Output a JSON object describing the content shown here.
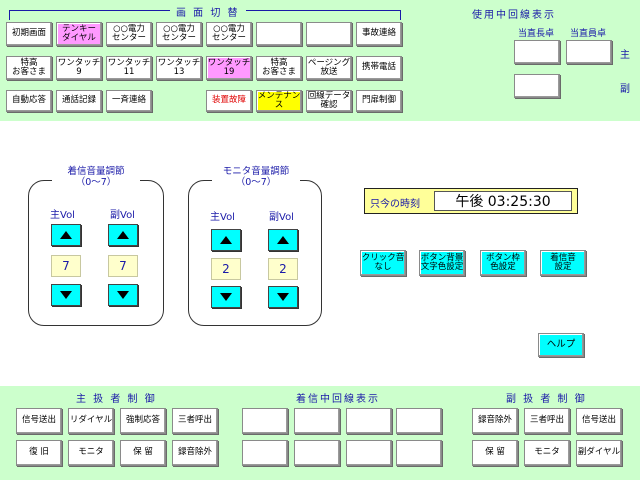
{
  "top_panel": {
    "screen_switch_title": "画 面 切 替",
    "line_in_use_title": "使用中回線表示",
    "duty_chief_label": "当直長卓",
    "duty_member_label": "当直員卓",
    "main_label": "主",
    "sub_label": "副",
    "row1": [
      "初期画面",
      "テンキー\nダイヤル",
      "○○電力\nセンター",
      "○○電力\nセンター",
      "○○電力\nセンター",
      "",
      "",
      "事故連絡"
    ],
    "row2": [
      "特高\nお客さま",
      "ワンタッチ\n9",
      "ワンタッチ\n11",
      "ワンタッチ\n13",
      "ワンタッチ\n19",
      "特高\nお客さま",
      "ページング\n放送",
      "携帯電話"
    ],
    "row3": [
      "自動応答",
      "通話記録",
      "一斉連絡",
      "装置故障",
      "メンテナン\nス",
      "回線データ\n確認",
      "門扉制御"
    ]
  },
  "incoming_volume": {
    "title": "着信音量調節\n（0〜7）",
    "main_label": "主Vol",
    "sub_label": "副Vol",
    "main_value": "7",
    "sub_value": "7"
  },
  "monitor_volume": {
    "title": "モニタ音量調節\n（0〜7）",
    "main_label": "主Vol",
    "sub_label": "副Vol",
    "main_value": "2",
    "sub_value": "2"
  },
  "clock": {
    "label": "只今の時刻",
    "time": "午後 03:25:30"
  },
  "settings_buttons": [
    "クリック音\nなし",
    "ボタン背景\n文字色設定",
    "ボタン枠\n色設定",
    "着信音\n設定"
  ],
  "help_label": "ヘルプ",
  "bottom_panel": {
    "main_handler_title": "主 扱 者 制 御",
    "incoming_line_title": "着信中回線表示",
    "sub_handler_title": "副 扱 者 制 御",
    "main_row1": [
      "信号送出",
      "リダイヤル",
      "強制応答",
      "三者呼出"
    ],
    "main_row2": [
      "復 旧",
      "モニタ",
      "保 留",
      "録音除外"
    ],
    "sub_row1": [
      "録音除外",
      "三者呼出",
      "信号送出"
    ],
    "sub_row2": [
      "保 留",
      "モニタ",
      "副ダイヤル"
    ]
  },
  "colors": {
    "panel_bg": "#ccffcc",
    "title_text": "#1a1aa8",
    "pink": "#ff99ff",
    "yellow": "#ffff00",
    "cyan": "#00ffff",
    "value_bg": "#ffffcc"
  }
}
